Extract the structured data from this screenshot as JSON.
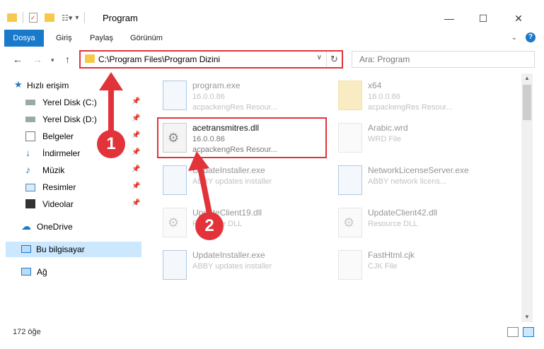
{
  "window": {
    "title": "Program",
    "minimize_icon": "—",
    "maximize_icon": "☐",
    "close_icon": "✕"
  },
  "ribbon": {
    "tabs": [
      "Dosya",
      "Giriş",
      "Paylaş",
      "Görünüm"
    ],
    "help": "?"
  },
  "address": {
    "path": "C:\\Program Files\\Program Dizini"
  },
  "search": {
    "placeholder": "Ara: Program"
  },
  "sidebar": {
    "items": [
      {
        "label": "Hızlı erişim",
        "icon": "star-icon"
      },
      {
        "label": "Yerel Disk (C:)",
        "icon": "drive-icon",
        "pinned": true
      },
      {
        "label": "Yerel Disk (D:)",
        "icon": "drive-icon",
        "pinned": true
      },
      {
        "label": "Belgeler",
        "icon": "documents-icon",
        "pinned": true
      },
      {
        "label": "İndirmeler",
        "icon": "download-icon",
        "pinned": true
      },
      {
        "label": "Müzik",
        "icon": "music-icon",
        "pinned": true
      },
      {
        "label": "Resimler",
        "icon": "pictures-icon",
        "pinned": true
      },
      {
        "label": "Videolar",
        "icon": "video-icon",
        "pinned": true
      },
      {
        "label": "OneDrive",
        "icon": "cloud-icon"
      },
      {
        "label": "Bu bilgisayar",
        "icon": "computer-icon",
        "selected": true
      },
      {
        "label": "Ağ",
        "icon": "network-icon"
      }
    ]
  },
  "files": [
    {
      "name": "program.exe",
      "meta1": "16.0.0.86",
      "meta2": "acpackengRes Resour..."
    },
    {
      "name": "x64",
      "meta1": "16.0.0.86",
      "meta2": "acpackengRes Resour..."
    },
    {
      "name": "acetransmitres.dll",
      "meta1": "16.0.0.86",
      "meta2": "acpackengRes Resour..."
    },
    {
      "name": "Arabic.wrd",
      "meta1": "WRD File",
      "meta2": ""
    },
    {
      "name": "UpdateInstaller.exe",
      "meta1": "ABBY updates installer",
      "meta2": ""
    },
    {
      "name": "NetworkLicenseServer.exe",
      "meta1": "ABBY network licens...",
      "meta2": ""
    },
    {
      "name": "UpdateClient19.dll",
      "meta1": "Resource DLL",
      "meta2": ""
    },
    {
      "name": "UpdateClient42.dll",
      "meta1": "Resource DLL",
      "meta2": ""
    },
    {
      "name": "UpdateInstaller.exe",
      "meta1": "ABBY updates installer",
      "meta2": ""
    },
    {
      "name": "FastHtml.cjk",
      "meta1": "CJK File",
      "meta2": ""
    }
  ],
  "status": {
    "count": "172 öğe"
  },
  "callouts": [
    "1",
    "2"
  ],
  "colors": {
    "accent": "#1979ca",
    "highlight": "#e2333a",
    "selected_bg": "#cce8ff"
  }
}
